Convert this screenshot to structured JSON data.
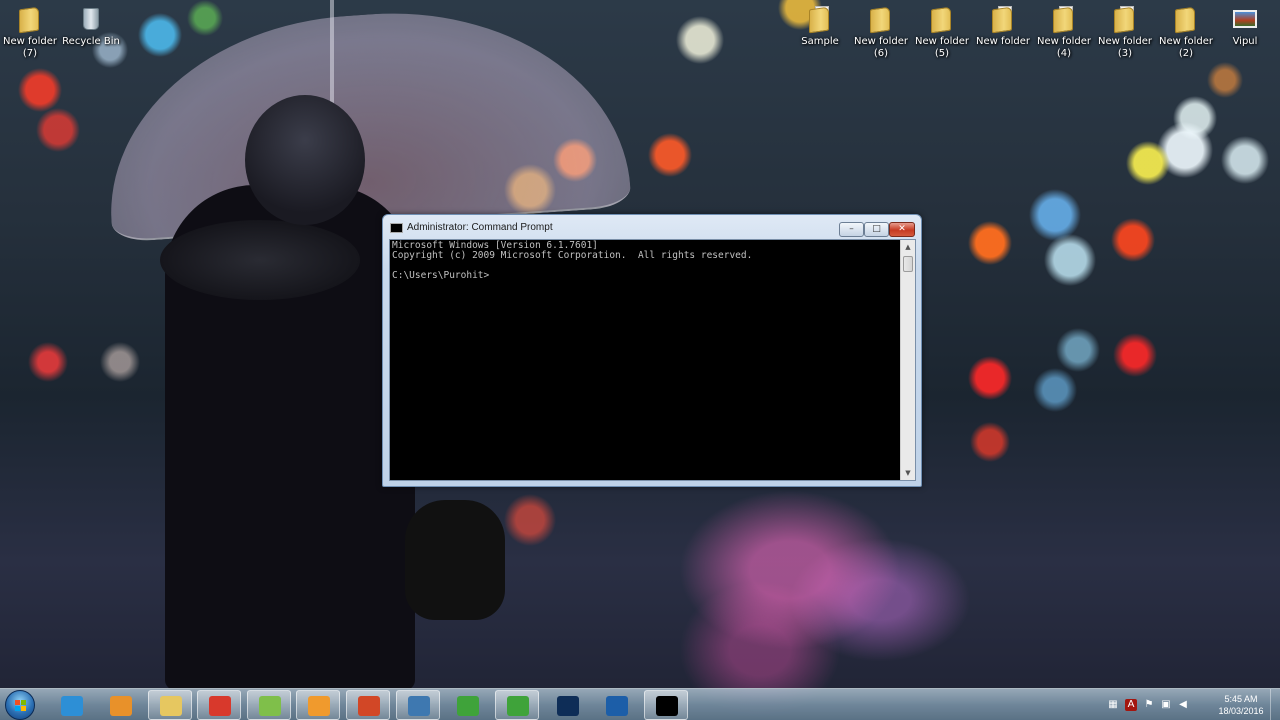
{
  "desktop": {
    "icons_left": [
      {
        "name": "desk-icon-new-folder-7",
        "label": "New folder\n(7)",
        "type": "folder"
      },
      {
        "name": "desk-icon-recycle-bin",
        "label": "Recycle Bin",
        "type": "bin"
      }
    ],
    "icons_right": [
      {
        "name": "desk-icon-sample",
        "label": "Sample",
        "type": "folder-doc"
      },
      {
        "name": "desk-icon-new-folder-6",
        "label": "New folder\n(6)",
        "type": "folder"
      },
      {
        "name": "desk-icon-new-folder-5",
        "label": "New folder\n(5)",
        "type": "folder"
      },
      {
        "name": "desk-icon-new-folder",
        "label": "New folder",
        "type": "folder-doc"
      },
      {
        "name": "desk-icon-new-folder-4",
        "label": "New folder\n(4)",
        "type": "folder-doc"
      },
      {
        "name": "desk-icon-new-folder-3",
        "label": "New folder\n(3)",
        "type": "folder-doc"
      },
      {
        "name": "desk-icon-new-folder-2",
        "label": "New folder\n(2)",
        "type": "folder"
      },
      {
        "name": "desk-icon-vipul",
        "label": "Vipul",
        "type": "picture"
      }
    ]
  },
  "cmd": {
    "title": "Administrator: Command Prompt",
    "icon_text": "C:\\",
    "buttons": {
      "minimize": "–",
      "maximize": "□",
      "close": "✕"
    },
    "lines": [
      "Microsoft Windows [Version 6.1.7601]",
      "Copyright (c) 2009 Microsoft Corporation.  All rights reserved.",
      "",
      "C:\\Users\\Purohit>"
    ],
    "scroll": {
      "up": "▲",
      "down": "▼"
    }
  },
  "taskbar": {
    "items": [
      {
        "name": "taskbar-internet-explorer",
        "icon": "internet-explorer-icon",
        "color": "#2d8fd6",
        "open": false
      },
      {
        "name": "taskbar-media-player",
        "icon": "media-player-icon",
        "color": "#e8912a",
        "open": false
      },
      {
        "name": "taskbar-file-explorer",
        "icon": "file-explorer-icon",
        "color": "#e6c760",
        "open": true
      },
      {
        "name": "taskbar-chrome",
        "icon": "chrome-icon",
        "color": "#d8392c",
        "open": true
      },
      {
        "name": "taskbar-notepad-plus",
        "icon": "notepad-plus-icon",
        "color": "#7fbf4a",
        "open": true
      },
      {
        "name": "taskbar-sublime-text",
        "icon": "sublime-text-icon",
        "color": "#f09a2d",
        "open": true
      },
      {
        "name": "taskbar-microsoft-office",
        "icon": "office-icon",
        "color": "#d24726",
        "open": true
      },
      {
        "name": "taskbar-python",
        "icon": "python-icon",
        "color": "#3e78b0",
        "open": true
      },
      {
        "name": "taskbar-camtasia",
        "icon": "camtasia-icon",
        "color": "#3fa33a",
        "open": false
      },
      {
        "name": "taskbar-camtasia-recorder",
        "icon": "camtasia-recorder-icon",
        "color": "#3fa33a",
        "open": true
      },
      {
        "name": "taskbar-photoshop",
        "icon": "photoshop-icon",
        "color": "#0e2d57",
        "open": false
      },
      {
        "name": "taskbar-media-center",
        "icon": "media-center-icon",
        "color": "#1c5ea8",
        "open": false
      },
      {
        "name": "taskbar-command-prompt",
        "icon": "command-prompt-icon",
        "color": "#000000",
        "open": true
      }
    ],
    "clock": {
      "time": "5:45 AM",
      "date": "18/03/2016"
    }
  }
}
